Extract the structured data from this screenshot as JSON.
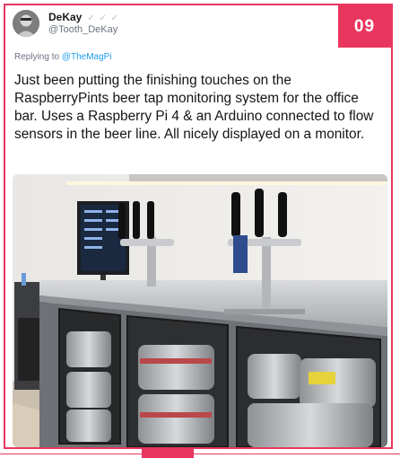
{
  "badge": {
    "number": "09"
  },
  "tweet": {
    "author_name": "DeKay",
    "author_decoration": "✓ ✓ ✓",
    "author_handle": "@Tooth_DeKay",
    "replying_prefix": "Replying to",
    "replying_handle": "@TheMagPi",
    "text": "Just been putting the finishing touches on the RaspberryPints beer tap monitoring system for the office bar. Uses a Raspberry Pi 4 & an Arduino connected to flow sensors in the beer line. All nicely displayed on a monitor."
  },
  "icons": {
    "avatar": "user-avatar",
    "verified": "pencil-decoration-icons"
  },
  "colors": {
    "accent": "#e9365f",
    "link": "#1d9bf0"
  }
}
